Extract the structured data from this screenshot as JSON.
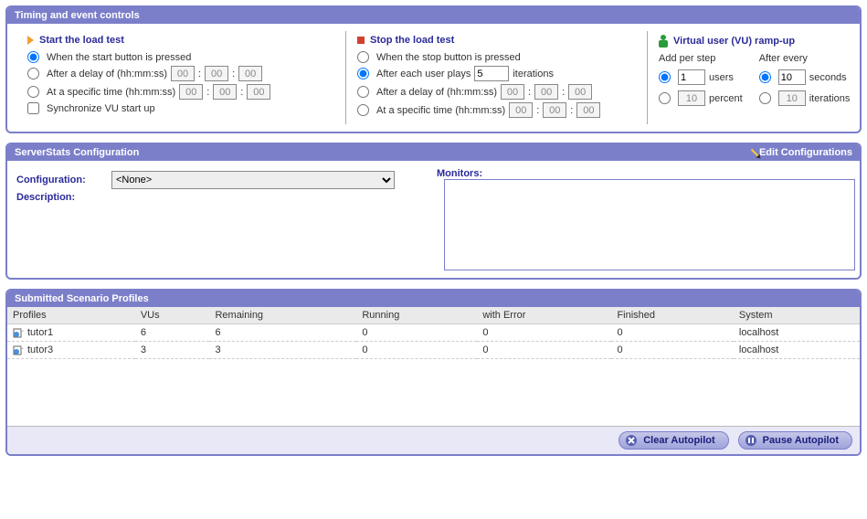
{
  "panel1": {
    "title": "Timing and event controls",
    "start": {
      "heading": "Start the load test",
      "opt1": "When the start button is pressed",
      "opt2": "After a delay of (hh:mm:ss)",
      "opt3": "At a specific time (hh:mm:ss)",
      "sync": "Synchronize VU start up",
      "h": "00",
      "m": "00",
      "s": "00",
      "h2": "00",
      "m2": "00",
      "s2": "00"
    },
    "stop": {
      "heading": "Stop the load test",
      "opt1": "When the stop button is pressed",
      "opt2a": "After each user plays",
      "opt2b": "iterations",
      "opt2val": "5",
      "opt3": "After a delay of (hh:mm:ss)",
      "opt4": "At a specific time (hh:mm:ss)",
      "h": "00",
      "m": "00",
      "s": "00",
      "h2": "00",
      "m2": "00",
      "s2": "00"
    },
    "ramp": {
      "heading": "Virtual user (VU) ramp-up",
      "addper": "Add per step",
      "afterevery": "After every",
      "users_val": "1",
      "users_lbl": "users",
      "percent_val": "10",
      "percent_lbl": "percent",
      "seconds_val": "10",
      "seconds_lbl": "seconds",
      "iter_val": "10",
      "iter_lbl": "iterations"
    }
  },
  "panel2": {
    "title": "ServerStats Configuration",
    "edit": "Edit Configurations",
    "config_lbl": "Configuration:",
    "config_val": "<None>",
    "desc_lbl": "Description:",
    "monitors_lbl": "Monitors:"
  },
  "panel3": {
    "title": "Submitted Scenario Profiles",
    "cols": [
      "Profiles",
      "VUs",
      "Remaining",
      "Running",
      "with Error",
      "Finished",
      "System"
    ],
    "rows": [
      {
        "name": "tutor1",
        "vus": "6",
        "remaining": "6",
        "running": "0",
        "error": "0",
        "finished": "0",
        "system": "localhost"
      },
      {
        "name": "tutor3",
        "vus": "3",
        "remaining": "3",
        "running": "0",
        "error": "0",
        "finished": "0",
        "system": "localhost"
      }
    ],
    "btn_clear": "Clear Autopilot",
    "btn_pause": "Pause Autopilot"
  }
}
